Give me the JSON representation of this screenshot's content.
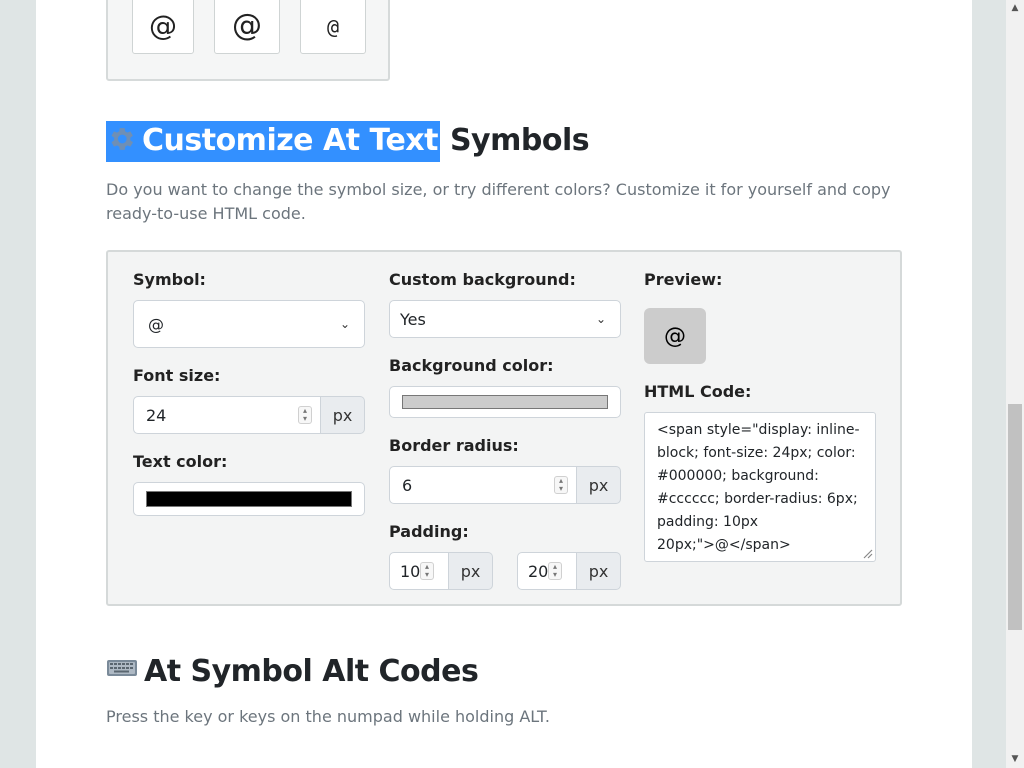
{
  "top_symbols": [
    "@",
    "@",
    "@"
  ],
  "customize": {
    "heading_highlight": "Customize At Text",
    "heading_rest": " Symbols",
    "description": "Do you want to change the symbol size, or try different colors? Customize it for yourself and copy ready-to-use HTML code.",
    "symbol": {
      "label": "Symbol:",
      "value": "@"
    },
    "font_size": {
      "label": "Font size:",
      "value": "24",
      "unit": "px"
    },
    "text_color": {
      "label": "Text color:",
      "value": "#000000"
    },
    "custom_background": {
      "label": "Custom background:",
      "value": "Yes"
    },
    "background_color": {
      "label": "Background color:",
      "value": "#cccccc"
    },
    "border_radius": {
      "label": "Border radius:",
      "value": "6",
      "unit": "px"
    },
    "padding": {
      "label": "Padding:",
      "vertical": "10",
      "horizontal": "20",
      "unit": "px"
    },
    "preview": {
      "label": "Preview:",
      "symbol": "@"
    },
    "html_code": {
      "label": "HTML Code:",
      "value": "<span style=\"display: inline-block; font-size: 24px; color: #000000; background: #cccccc; border-radius: 6px; padding: 10px 20px;\">@</span>"
    }
  },
  "alt_codes": {
    "heading": "At Symbol Alt Codes",
    "description": "Press the key or keys on the numpad while holding ALT."
  },
  "colors": {
    "highlight": "#3390ff",
    "panel_bg": "#f3f4f4",
    "page_bg": "#dfe5e5"
  }
}
